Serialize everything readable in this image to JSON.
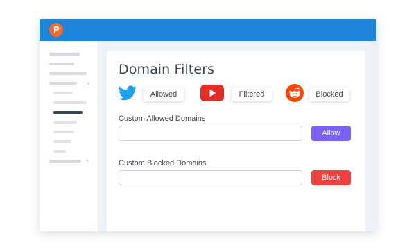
{
  "app": {
    "logo_icon": "pihole-shield-icon",
    "titlebar_color": "#1d86db"
  },
  "sidebar": {
    "items": [
      {
        "type": "nav",
        "state": "default"
      },
      {
        "type": "nav",
        "state": "default"
      },
      {
        "type": "nav",
        "state": "default"
      },
      {
        "type": "nav-group",
        "state": "expanded"
      },
      {
        "type": "sub",
        "state": "default"
      },
      {
        "type": "sub",
        "state": "default"
      },
      {
        "type": "sub",
        "state": "active"
      },
      {
        "type": "sub",
        "state": "default"
      },
      {
        "type": "sub",
        "state": "default"
      },
      {
        "type": "sub",
        "state": "default"
      },
      {
        "type": "sub",
        "state": "default"
      },
      {
        "type": "nav-group",
        "state": "collapsed"
      }
    ]
  },
  "main": {
    "title": "Domain Filters",
    "services": [
      {
        "icon": "twitter-icon",
        "status": "Allowed",
        "color": "#1da1f2"
      },
      {
        "icon": "youtube-icon",
        "status": "Filtered",
        "color": "#e52d27"
      },
      {
        "icon": "reddit-icon",
        "status": "Blocked",
        "color": "#ff4500"
      }
    ],
    "allowed": {
      "label": "Custom Allowed Domains",
      "value": "",
      "placeholder": "",
      "button": "Allow",
      "button_color": "#7b61f5"
    },
    "blocked": {
      "label": "Custom Blocked Domains",
      "value": "",
      "placeholder": "",
      "button": "Block",
      "button_color": "#f2403f"
    }
  }
}
